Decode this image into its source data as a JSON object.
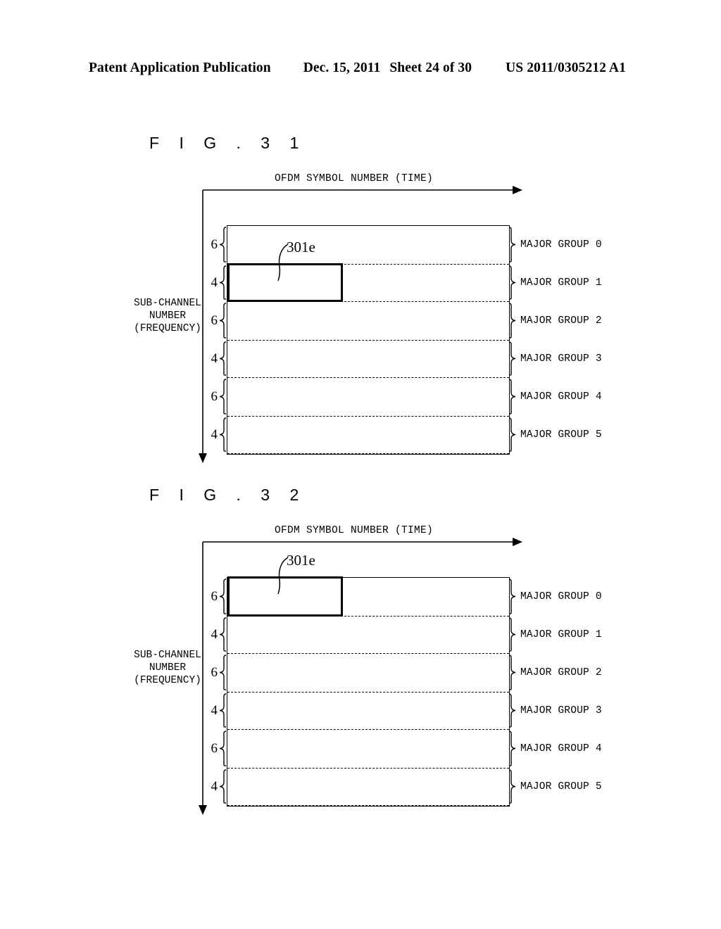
{
  "header": {
    "title": "Patent Application Publication",
    "date": "Dec. 15, 2011",
    "sheet": "Sheet 24 of 30",
    "publication_number": "US 2011/0305212 A1"
  },
  "figures": [
    {
      "id": "figure-31",
      "title": "F I G .  3 1",
      "x_axis_label": "OFDM SYMBOL NUMBER (TIME)",
      "y_axis_label_lines": [
        "SUB-CHANNEL",
        "NUMBER",
        "(FREQUENCY)"
      ],
      "row_sizes": [
        "6",
        "4",
        "6",
        "4",
        "6",
        "4"
      ],
      "group_labels": [
        "MAJOR GROUP 0",
        "MAJOR GROUP 1",
        "MAJOR GROUP 2",
        "MAJOR GROUP 3",
        "MAJOR GROUP 4",
        "MAJOR GROUP 5"
      ],
      "allocation": {
        "reference": "301e",
        "group_index": 1,
        "group_label": "MAJOR GROUP 1",
        "sub_channels": "4",
        "width_fraction": 0.41
      }
    },
    {
      "id": "figure-32",
      "title": "F I G .  3 2",
      "x_axis_label": "OFDM SYMBOL NUMBER (TIME)",
      "y_axis_label_lines": [
        "SUB-CHANNEL",
        "NUMBER",
        "(FREQUENCY)"
      ],
      "row_sizes": [
        "6",
        "4",
        "6",
        "4",
        "6",
        "4"
      ],
      "group_labels": [
        "MAJOR GROUP 0",
        "MAJOR GROUP 1",
        "MAJOR GROUP 2",
        "MAJOR GROUP 3",
        "MAJOR GROUP 4",
        "MAJOR GROUP 5"
      ],
      "allocation": {
        "reference": "301e",
        "group_index": 0,
        "group_label": "MAJOR GROUP 0",
        "sub_channels": "6",
        "width_fraction": 0.41
      }
    }
  ],
  "colors": {
    "ink": "#000000",
    "paper": "#ffffff"
  }
}
